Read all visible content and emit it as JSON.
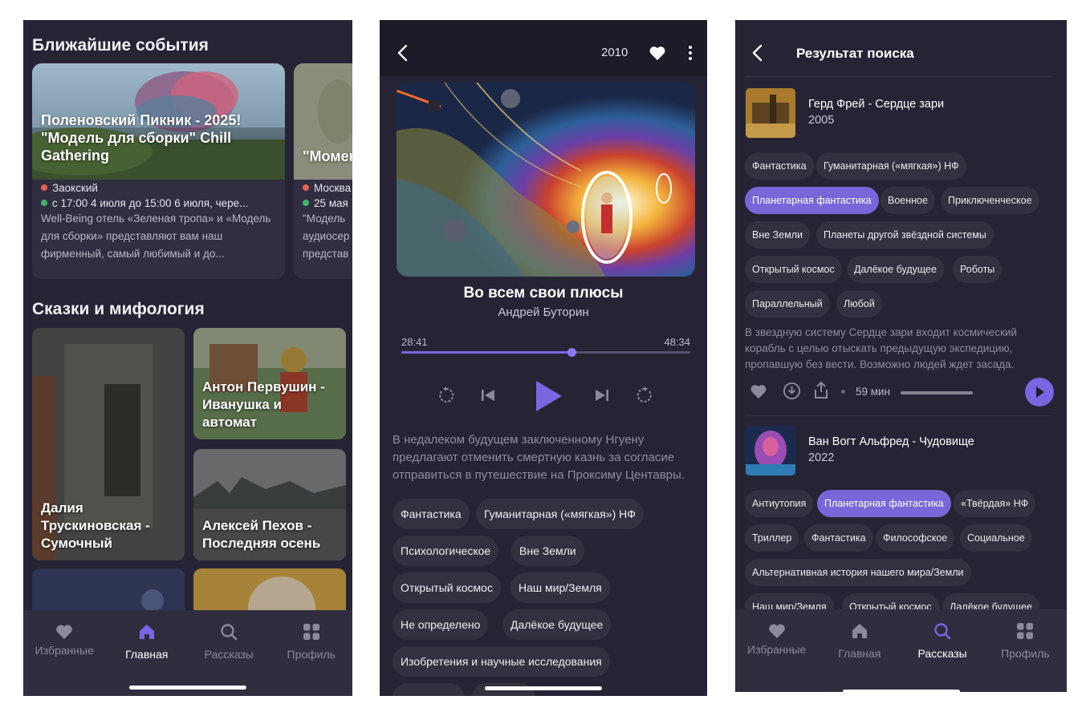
{
  "screen1": {
    "section_events_title": "Ближайшие события",
    "events": [
      {
        "title": "Поленовский Пикник - 2025! \"Модель для сборки\" Chill Gathering",
        "location": "Заокский",
        "date": "с 17:00 4 июля до 15:00 6 июля, чере...",
        "description": "Well-Being отель «Зеленая тропа» и «Модель для сборки»  представляют вам наш фирменный, самый любимый и до..."
      },
      {
        "title": "\"Момен",
        "location": "Москва",
        "date": "25 мая",
        "description": "\"Модель аудиосер представ"
      }
    ],
    "section_tales_title": "Сказки и мифология",
    "tiles": [
      "Далия Трускиновская - Сумочный",
      "Антон Первушин - Иванушка и автомат",
      "Алексей Пехов - Последняя осень"
    ]
  },
  "tabbar": {
    "tabs": [
      {
        "label": "Избранные",
        "icon": "heart-icon"
      },
      {
        "label": "Главная",
        "icon": "home-icon"
      },
      {
        "label": "Рассказы",
        "icon": "search-icon"
      },
      {
        "label": "Профиль",
        "icon": "grid-icon"
      }
    ],
    "active_color": "#7a66e0",
    "inactive_color": "#8c8a99"
  },
  "screen2": {
    "year": "2010",
    "track_title": "Во всем свои плюсы",
    "author": "Андрей Буторин",
    "elapsed": "28:41",
    "total": "48:34",
    "progress": 0.59,
    "description": "В недалеком будущем заключенному Нгуену предлагают отменить смертную казнь за согласие отправиться в путешествие на Проксиму Центавры.",
    "tags": [
      "Фантастика",
      "Гуманитарная («мягкая») НФ",
      "Психологическое",
      "Вне Земли",
      "Открытый космос",
      "Наш мир/Земля",
      "Не определено",
      "Далёкое будущее",
      "Изобретения и научные исследования"
    ]
  },
  "screen3": {
    "title": "Результат поиска",
    "results": [
      {
        "title": "Герд Фрей - Сердце зари",
        "year": "2005",
        "tags": [
          "Фантастика",
          "Гуманитарная («мягкая») НФ",
          "Планетарная фантастика",
          "Военное",
          "Приключенческое",
          "Вне Земли",
          "Планеты  другой звёздной системы",
          "Открытый космос",
          "Далёкое будущее",
          "Роботы",
          "Параллельный",
          "Любой"
        ],
        "selected_tag": "Планетарная фантастика",
        "description": "В звездную систему Сердце зари входит космический корабль с целью отыскать предыдущую экспедицию, пропавшую без вести. Возможно людей ждет засада.",
        "duration": "59 мин"
      },
      {
        "title": "Ван Вогт Альфред - Чудовище",
        "year": "2022",
        "tags": [
          "Антиутопия",
          "Планетарная фантастика",
          "«Твёрдая» НФ",
          "Триллер",
          "Фантастика",
          "Философское",
          "Социальное",
          "Альтернативная история нашего мира/Земли",
          "Наш мир/Земля",
          "Открытый космос",
          "Далёкое будущее"
        ],
        "selected_tag": "Планетарная фантастика"
      }
    ]
  }
}
